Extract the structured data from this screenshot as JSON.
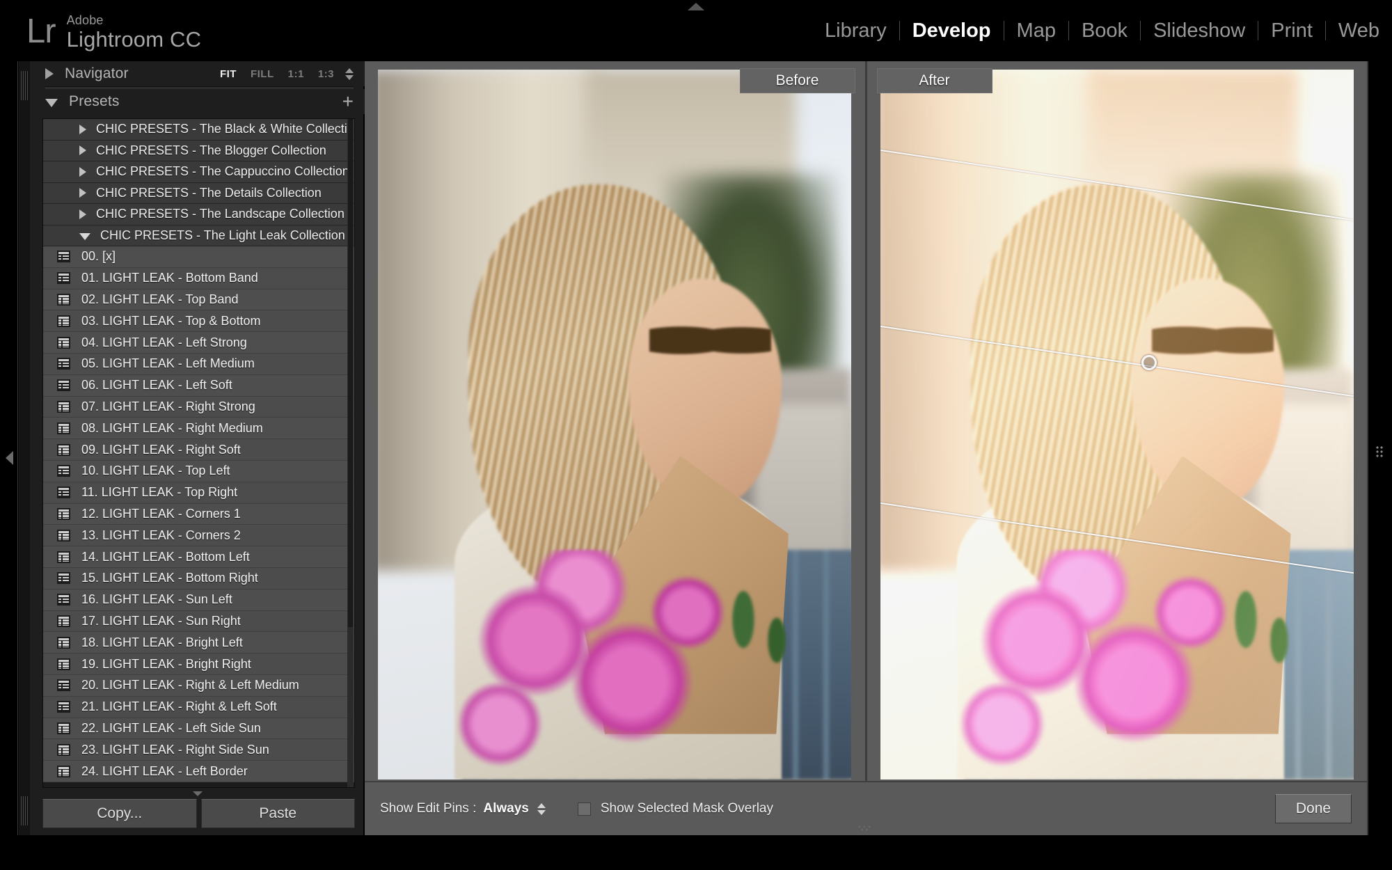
{
  "app": {
    "vendor": "Adobe",
    "name": "Lightroom CC",
    "logo_mark": "Lr"
  },
  "modules": [
    {
      "label": "Library",
      "active": false
    },
    {
      "label": "Develop",
      "active": true
    },
    {
      "label": "Map",
      "active": false
    },
    {
      "label": "Book",
      "active": false
    },
    {
      "label": "Slideshow",
      "active": false
    },
    {
      "label": "Print",
      "active": false
    },
    {
      "label": "Web",
      "active": false
    }
  ],
  "navigator": {
    "title": "Navigator",
    "zoom_levels": [
      {
        "label": "FIT",
        "active": true
      },
      {
        "label": "FILL",
        "active": false
      },
      {
        "label": "1:1",
        "active": false
      },
      {
        "label": "1:3",
        "active": false
      }
    ]
  },
  "presets": {
    "title": "Presets",
    "add_label": "+",
    "collections": [
      {
        "label": "CHIC PRESETS - The Black & White Collection",
        "expanded": false
      },
      {
        "label": "CHIC PRESETS - The Blogger Collection",
        "expanded": false
      },
      {
        "label": "CHIC PRESETS - The Cappuccino Collection",
        "expanded": false
      },
      {
        "label": "CHIC PRESETS - The Details Collection",
        "expanded": false
      },
      {
        "label": "CHIC PRESETS - The Landscape Collection",
        "expanded": false
      },
      {
        "label": "CHIC PRESETS - The Light Leak Collection",
        "expanded": true
      }
    ],
    "items": [
      "00. [x]",
      "01. LIGHT LEAK - Bottom Band",
      "02. LIGHT LEAK - Top Band",
      "03. LIGHT LEAK - Top & Bottom",
      "04. LIGHT LEAK  - Left Strong",
      "05. LIGHT LEAK -  Left Medium",
      "06. LIGHT LEAK - Left Soft",
      "07. LIGHT LEAK - Right Strong",
      "08. LIGHT LEAK - Right Medium",
      "09. LIGHT LEAK - Right Soft",
      "10. LIGHT LEAK -  Top Left",
      "11. LIGHT LEAK - Top Right",
      "12. LIGHT LEAK - Corners 1",
      "13. LIGHT LEAK - Corners 2",
      "14. LIGHT LEAK - Bottom Left",
      "15. LIGHT LEAK - Bottom Right",
      "16. LIGHT LEAK - Sun Left",
      "17. LIGHT LEAK - Sun Right",
      "18. LIGHT LEAK -  Bright Left",
      "19. LIGHT LEAK -  Bright Right",
      "20. LIGHT LEAK  - Right & Left Medium",
      "21. LIGHT LEAK -  Right & Left Soft",
      "22. LIGHT LEAK - Left Side Sun",
      "23. LIGHT LEAK - Right Side Sun",
      "24. LIGHT LEAK - Left Border"
    ]
  },
  "panel_buttons": {
    "copy_label": "Copy...",
    "paste_label": "Paste"
  },
  "compare": {
    "before_label": "Before",
    "after_label": "After"
  },
  "toolbar": {
    "show_edit_pins_label": "Show Edit Pins :",
    "show_edit_pins_value": "Always",
    "show_mask_overlay_label": "Show Selected Mask Overlay",
    "show_mask_overlay_checked": false,
    "done_label": "Done"
  },
  "colors": {
    "panel_bg": "#1e1e1e",
    "preset_row_bg": "#4e4e4e",
    "collection_row_bg": "#3a3a3a",
    "content_bg": "#5a5a5a",
    "accent_text": "#ffffff"
  }
}
